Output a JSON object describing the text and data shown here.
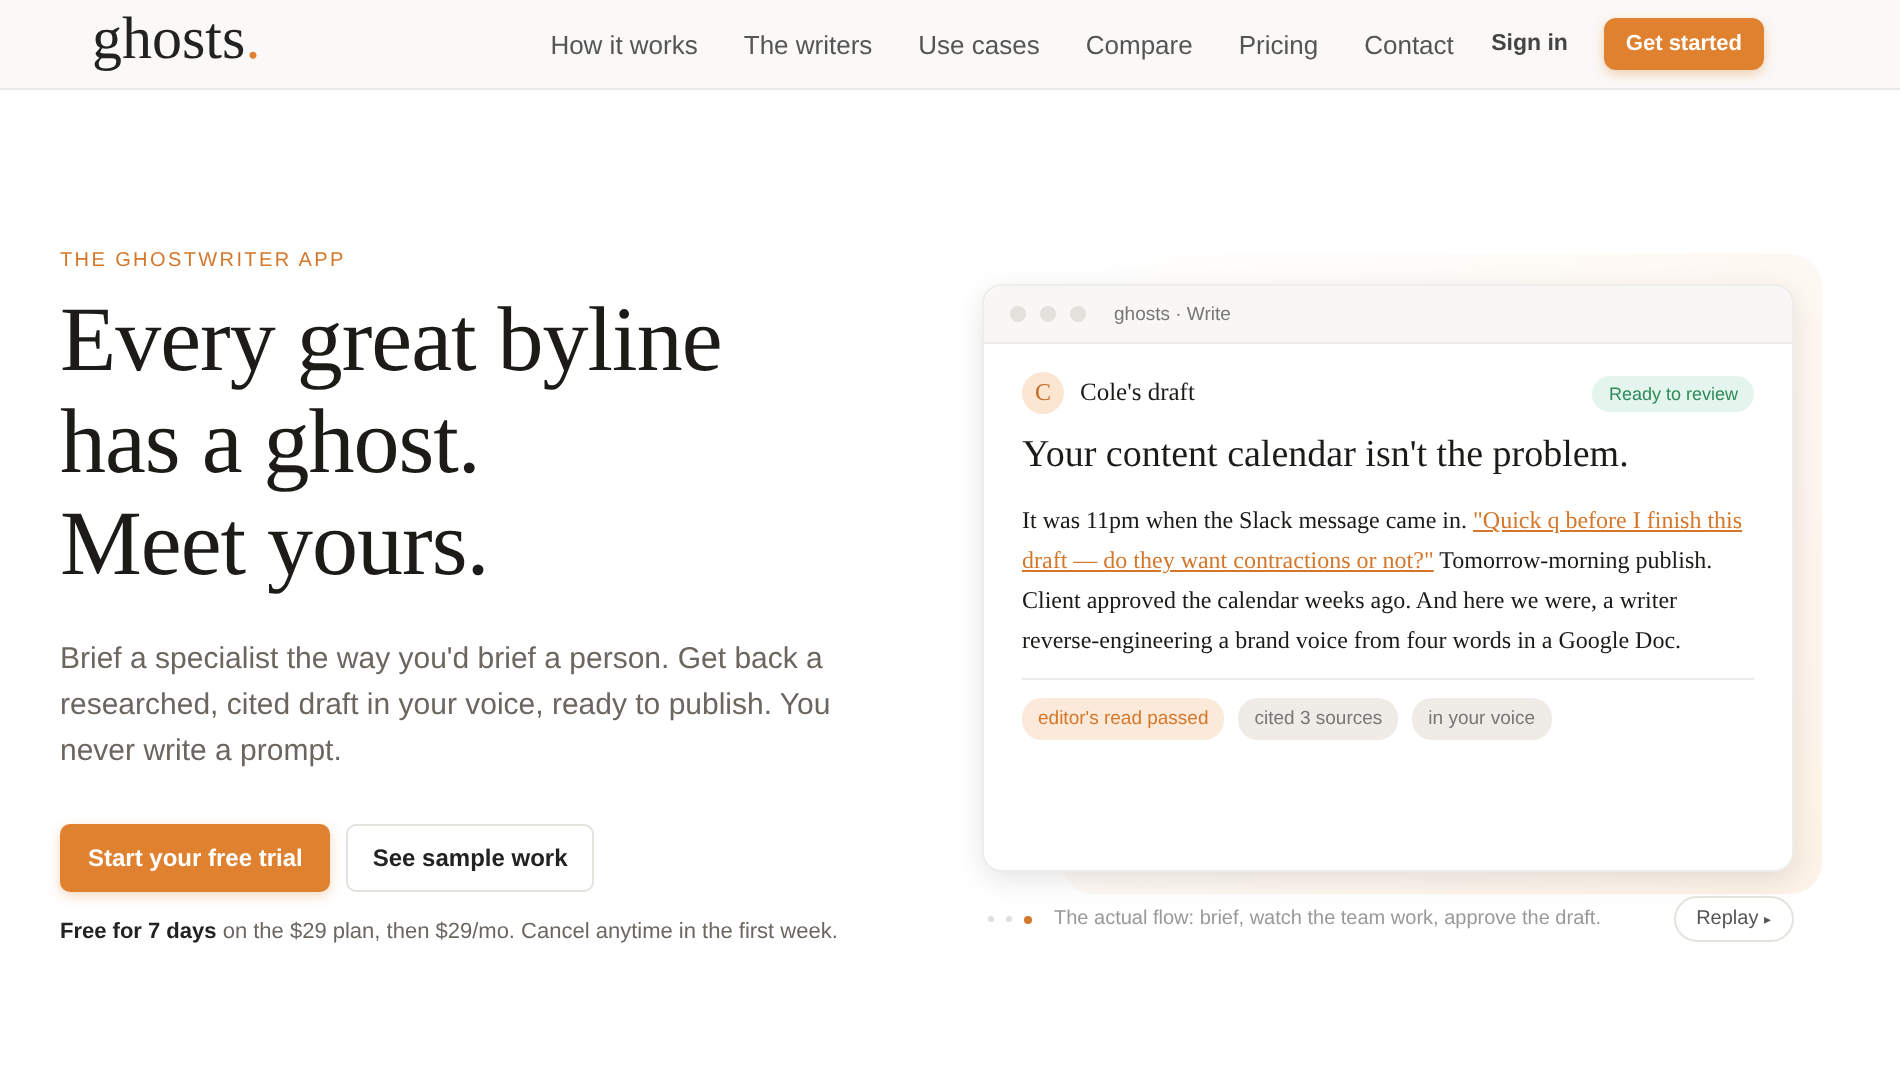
{
  "nav": {
    "logo": "ghosts",
    "logo_mark": ".",
    "links": [
      "How it works",
      "The writers",
      "Use cases",
      "Compare",
      "Pricing",
      "Contact"
    ],
    "sign_in": "Sign in",
    "cta": "Get started"
  },
  "hero": {
    "eyebrow": "THE GHOSTWRITER APP",
    "headline": [
      "Every great byline",
      "has a ghost.",
      "Meet yours."
    ],
    "lede": "Brief a specialist the way you'd brief a person. Get back a researched, cited draft in your voice, ready to publish. You never write a prompt.",
    "primary": "Start your free trial",
    "secondary": "See sample work",
    "note": "**Free for 7 days** on the $29 plan, then $29/mo. Cancel anytime in the first week."
  },
  "preview": {
    "window_title": "ghosts · Write",
    "avatar": "C",
    "draft": "Cole's draft",
    "status": "Ready to review",
    "title": "Your content calendar isn't the problem.",
    "body": [
      {
        "kind": "text",
        "text": "It was 11pm when the Slack message came in. "
      },
      {
        "kind": "quote",
        "text": "\"Quick q before I finish this draft — do they want contractions or not?\""
      },
      {
        "kind": "text",
        "text": " Tomorrow-morning publish. Client approved the calendar weeks ago. And here we were, a writer reverse-engineering a brand voice from four words in a Google Doc."
      }
    ],
    "tags": [
      {
        "label": "editor's read passed",
        "kind": "accent"
      },
      {
        "label": "cited 3 sources",
        "kind": "neutral"
      },
      {
        "label": "in your voice",
        "kind": "neutral"
      }
    ]
  },
  "flow": {
    "steps": [
      {
        "selected": false
      },
      {
        "selected": false
      },
      {
        "selected": true
      }
    ],
    "caption": "The actual flow: brief, watch the team work, approve the draft.",
    "replay": "Replay",
    "replay_icon": "▸"
  }
}
